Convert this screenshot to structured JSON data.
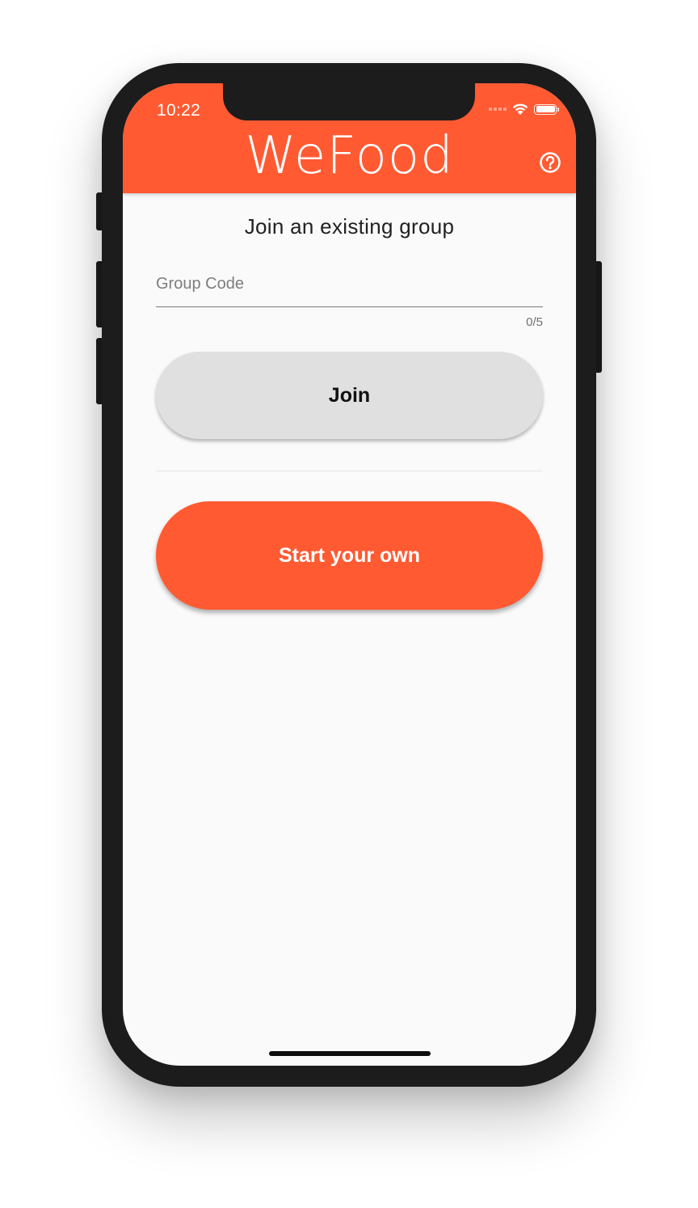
{
  "status_bar": {
    "time": "10:22"
  },
  "app_bar": {
    "logo_text": "WeFood",
    "help_icon": "help-circle-icon",
    "background_color": "#ff5a32"
  },
  "join_section": {
    "heading": "Join an existing group",
    "group_code_input": {
      "placeholder": "Group Code",
      "value": "",
      "counter": "0/5"
    },
    "join_button_label": "Join"
  },
  "start_section": {
    "start_button_label": "Start your own"
  },
  "colors": {
    "accent": "#ff5a32",
    "join_button_bg": "#e0e0e0",
    "screen_bg": "#fafafa"
  }
}
